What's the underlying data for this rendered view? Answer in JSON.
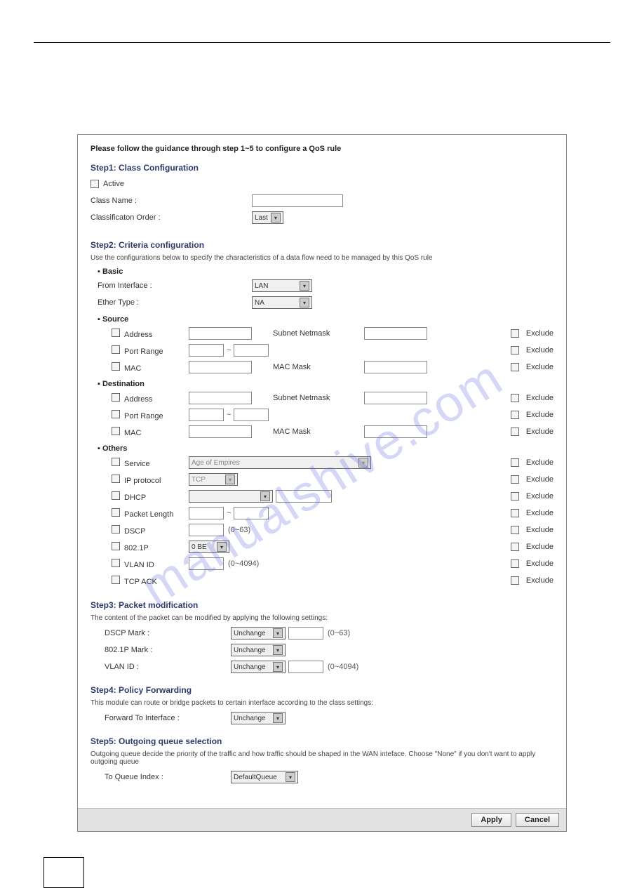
{
  "watermark": "manualshive.com",
  "intro": "Please follow the guidance through step 1~5 to configure a QoS rule",
  "step1": {
    "title": "Step1: Class Configuration",
    "active": "Active",
    "className": "Class Name :",
    "order": "Classificaton Order :",
    "orderValue": "Last"
  },
  "step2": {
    "title": "Step2: Criteria configuration",
    "hint": "Use the configurations below to specify the characteristics of a data flow need to be managed by this QoS rule",
    "basic": "Basic",
    "fromInterface": "From Interface :",
    "fromInterfaceValue": "LAN",
    "etherType": "Ether Type :",
    "etherTypeValue": "NA",
    "source": "Source",
    "destination": "Destination",
    "others": "Others",
    "address": "Address",
    "subnetNetmask": "Subnet Netmask",
    "portRange": "Port Range",
    "mac": "MAC",
    "macMask": "MAC Mask",
    "service": "Service",
    "serviceValue": "Age of Empires",
    "ipProtocol": "IP protocol",
    "ipProtocolValue": "TCP",
    "dhcp": "DHCP",
    "packetLength": "Packet Length",
    "dscp": "DSCP",
    "dscpRange": "(0~63)",
    "p8021": "802.1P",
    "p8021Value": "0 BE",
    "vlanId": "VLAN ID",
    "vlanRange": "(0~4094)",
    "tcpAck": "TCP ACK",
    "exclude": "Exclude"
  },
  "step3": {
    "title": "Step3: Packet modification",
    "hint": "The content of the packet can be modified by applying the following settings:",
    "dscpMark": "DSCP Mark :",
    "p8021Mark": "802.1P Mark :",
    "vlanId": "VLAN ID :",
    "unchange": "Unchange",
    "dscpRange": "(0~63)",
    "vlanRange": "(0~4094)"
  },
  "step4": {
    "title": "Step4: Policy Forwarding",
    "hint": "This module can route or bridge packets to certain interface according to the class settings:",
    "forwardTo": "Forward To Interface :",
    "unchange": "Unchange"
  },
  "step5": {
    "title": "Step5: Outgoing queue selection",
    "hint": "Outgoing queue decide the priority of the traffic and how traffic should be shaped in the WAN inteface. Choose \"None\" if you don't want to apply outgoing queue",
    "toQueue": "To Queue Index :",
    "toQueueValue": "DefaultQueue"
  },
  "buttons": {
    "apply": "Apply",
    "cancel": "Cancel"
  }
}
